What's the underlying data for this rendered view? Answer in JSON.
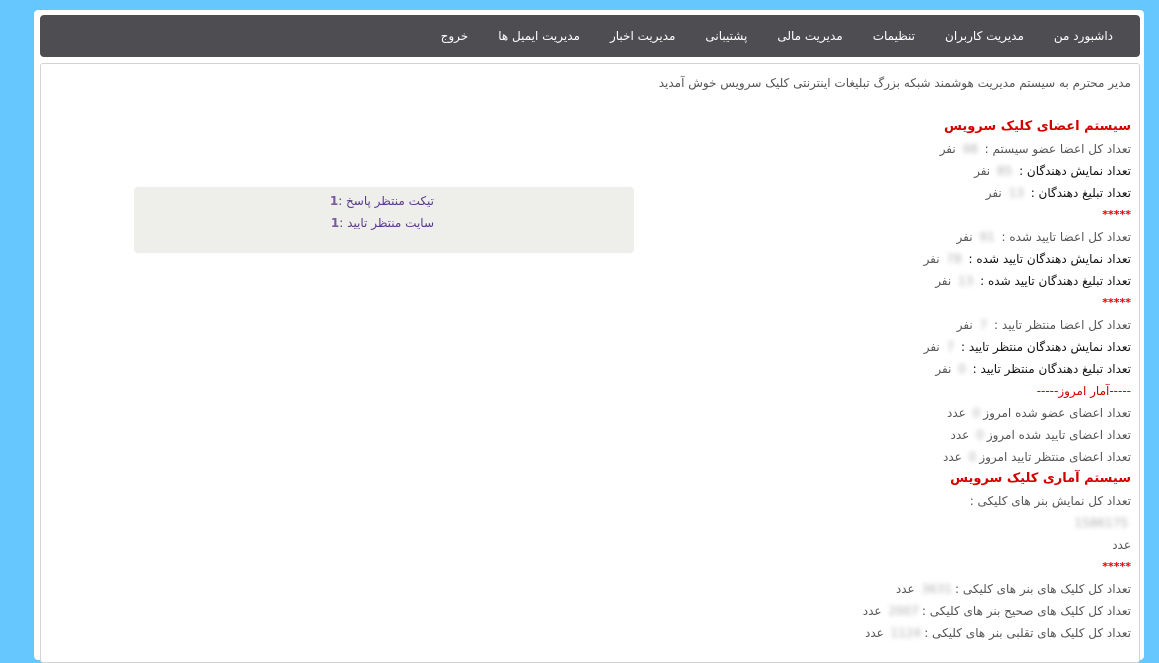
{
  "nav": {
    "items": [
      "داشبورد من",
      "مدیریت کاربران",
      "تنظیمات",
      "مدیریت مالی",
      "پشتیبانی",
      "مدیریت اخبار",
      "مدیریت ایمیل ها",
      "خروج"
    ]
  },
  "welcome": "مدیر محترم به سیستم مدیریت هوشمند شبکه بزرگ تبلیغات اینترنتی کلیک سرویس خوش آمدید",
  "members": {
    "heading": "سیستم اعضای کلیک سرویس",
    "total_label": "تعداد کل اعضا عضو سیستم :",
    "total_value": "98",
    "publishers_label": "تعداد نمایش دهندگان :",
    "publishers_value": "85",
    "advertisers_label": "تعداد تبلیغ دهندگان :",
    "advertisers_value": "13",
    "unit": "نفر",
    "stars": "*****",
    "approved_total_label": "تعداد کل اعضا تایید شده :",
    "approved_total_value": "91",
    "approved_publishers_label": "تعداد نمایش دهندگان تایید شده :",
    "approved_publishers_value": "78",
    "approved_advertisers_label": "تعداد تبلیغ دهندگان تایید شده :",
    "approved_advertisers_value": "13",
    "pending_total_label": "تعداد کل اعضا منتظر تایید :",
    "pending_total_value": "7",
    "pending_publishers_label": "تعداد نمایش دهندگان منتظر تایید :",
    "pending_publishers_value": "7",
    "pending_advertisers_label": "تعداد تبلیغ دهندگان منتظر تایید :",
    "pending_advertisers_value": "0",
    "today_heading": "-----آمار امروز-----",
    "today_joined_label": "تعداد اعضای عضو شده امروز",
    "today_joined_value": "0",
    "today_approved_label": "تعداد اعضای تایید شده امروز",
    "today_approved_value": "0",
    "today_pending_label": "تعداد اعضای منتظر تایید امروز",
    "today_pending_value": "0",
    "count_unit": "عدد"
  },
  "stats": {
    "heading": "سیستم آماری کلیک سرویس",
    "impressions_label": "تعداد کل نمایش بنر های کلیکی :",
    "impressions_value": "1586175",
    "unit": "عدد",
    "stars": "*****",
    "clicks_label": "تعداد کل کلیک های بنر های کلیکی :",
    "clicks_value": "3631",
    "valid_clicks_label": "تعداد کل کلیک های صحیح بنر های کلیکی :",
    "valid_clicks_value": "2007",
    "fraud_clicks_label": "تعداد کل کلیک های تقلبی بنر های کلیکی :",
    "fraud_clicks_value": "1124"
  },
  "widget": {
    "tickets_label": "تیکت منتظر پاسخ :",
    "tickets_value": "1",
    "sites_label": "سایت منتظر تایید :",
    "sites_value": "1"
  }
}
